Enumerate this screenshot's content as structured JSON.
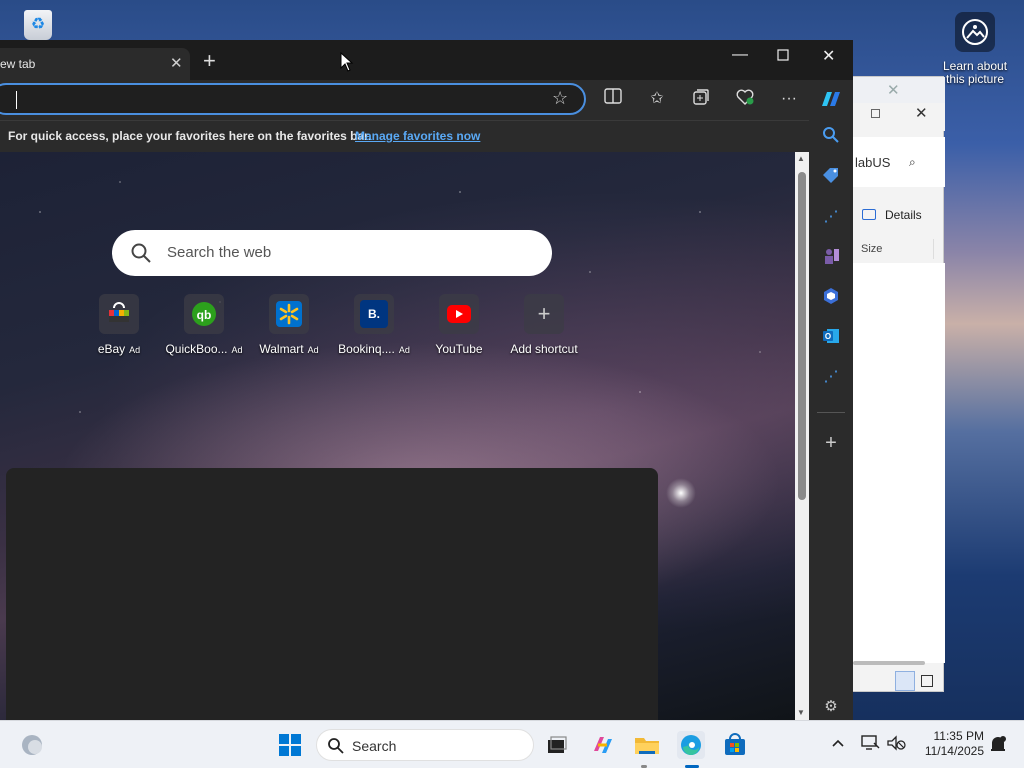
{
  "desktop": {
    "learn_label": "Learn about this picture"
  },
  "explorer": {
    "search_text": "labUS",
    "details_label": "Details",
    "size_header": "Size"
  },
  "browser": {
    "tab_title": "ew tab",
    "favbar_text": "For quick access, place your favorites here on the favorites bar.",
    "favbar_link": "Manage favorites now",
    "search_placeholder": "Search the web",
    "shortcuts": [
      {
        "label": "eBay",
        "ad": "Ad"
      },
      {
        "label": "QuickBoo...",
        "ad": "Ad"
      },
      {
        "label": "Walmart",
        "ad": "Ad"
      },
      {
        "label": "Bookinq....",
        "ad": "Ad"
      },
      {
        "label": "YouTube",
        "ad": ""
      },
      {
        "label": "Add shortcut",
        "ad": ""
      }
    ],
    "booking_letter": "B."
  },
  "taskbar": {
    "search_label": "Search",
    "time": "11:35 PM",
    "date": "11/14/2025"
  },
  "colors": {
    "accent": "#4a8fe0",
    "link": "#5aa9f5"
  }
}
